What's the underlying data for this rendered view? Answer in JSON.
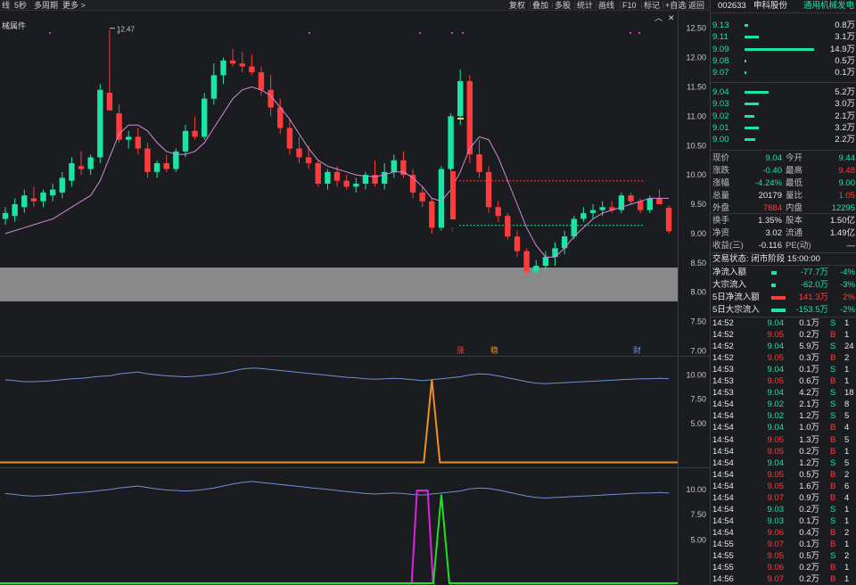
{
  "toolbar": {
    "left": [
      "线",
      "5秒",
      "多周期",
      "更多 >"
    ],
    "right": [
      "复权",
      "叠加",
      "多股",
      "统计",
      "画线",
      "F10",
      "标记",
      "+自选",
      "返回"
    ],
    "icons": [
      "chevron-up-icon",
      "close-icon"
    ]
  },
  "chart": {
    "indicator_label": "械属件",
    "high_label": "12.47",
    "signal_labels": [
      "涨",
      "稳",
      "财"
    ],
    "price_axis": [
      "12.50",
      "12.00",
      "11.50",
      "11.00",
      "10.50",
      "10.00",
      "9.50",
      "9.00",
      "8.50",
      "8.00",
      "7.50",
      "7.00"
    ],
    "sub1_axis": [
      "10.00",
      "7.50",
      "5.00"
    ],
    "sub2_axis": [
      "10.00",
      "7.50",
      "5.00"
    ],
    "colors": {
      "up": "#19e6a5",
      "down": "#ff3c3c",
      "ma": "#d08cd8",
      "blue": "#6e90d8",
      "orange": "#f0901e",
      "magenta": "#e020e0",
      "green": "#20e020",
      "gray_band": "#888888"
    }
  },
  "chart_data": {
    "type": "candlestick",
    "ylim": [
      6.9,
      12.8
    ],
    "candles": [
      {
        "o": 9.25,
        "h": 9.45,
        "l": 9.15,
        "c": 9.35
      },
      {
        "o": 9.3,
        "h": 9.6,
        "l": 9.2,
        "c": 9.5
      },
      {
        "o": 9.45,
        "h": 9.75,
        "l": 9.35,
        "c": 9.65
      },
      {
        "o": 9.6,
        "h": 9.8,
        "l": 9.45,
        "c": 9.55
      },
      {
        "o": 9.55,
        "h": 9.75,
        "l": 9.45,
        "c": 9.7
      },
      {
        "o": 9.65,
        "h": 9.85,
        "l": 9.55,
        "c": 9.75
      },
      {
        "o": 9.7,
        "h": 10.05,
        "l": 9.6,
        "c": 9.95
      },
      {
        "o": 9.9,
        "h": 10.3,
        "l": 9.8,
        "c": 10.2
      },
      {
        "o": 10.15,
        "h": 10.4,
        "l": 10.0,
        "c": 10.1
      },
      {
        "o": 10.1,
        "h": 10.35,
        "l": 10.0,
        "c": 10.3
      },
      {
        "o": 10.3,
        "h": 11.55,
        "l": 10.2,
        "c": 11.45
      },
      {
        "o": 11.4,
        "h": 12.47,
        "l": 11.1,
        "c": 11.1
      },
      {
        "o": 11.05,
        "h": 11.2,
        "l": 10.55,
        "c": 10.6
      },
      {
        "o": 10.6,
        "h": 10.75,
        "l": 10.45,
        "c": 10.65
      },
      {
        "o": 10.65,
        "h": 10.8,
        "l": 10.35,
        "c": 10.45
      },
      {
        "o": 10.45,
        "h": 10.55,
        "l": 9.95,
        "c": 10.05
      },
      {
        "o": 10.05,
        "h": 10.25,
        "l": 9.95,
        "c": 10.2
      },
      {
        "o": 10.2,
        "h": 10.35,
        "l": 10.05,
        "c": 10.1
      },
      {
        "o": 10.1,
        "h": 10.45,
        "l": 10.05,
        "c": 10.4
      },
      {
        "o": 10.4,
        "h": 10.85,
        "l": 10.3,
        "c": 10.75
      },
      {
        "o": 10.75,
        "h": 11.0,
        "l": 10.6,
        "c": 10.65
      },
      {
        "o": 10.65,
        "h": 11.4,
        "l": 10.6,
        "c": 11.3
      },
      {
        "o": 11.3,
        "h": 11.9,
        "l": 11.2,
        "c": 11.7
      },
      {
        "o": 11.7,
        "h": 12.0,
        "l": 11.55,
        "c": 11.95
      },
      {
        "o": 11.95,
        "h": 12.15,
        "l": 11.85,
        "c": 11.9
      },
      {
        "o": 11.9,
        "h": 12.1,
        "l": 11.75,
        "c": 11.85
      },
      {
        "o": 11.85,
        "h": 12.05,
        "l": 11.7,
        "c": 11.75
      },
      {
        "o": 11.75,
        "h": 11.85,
        "l": 11.35,
        "c": 11.45
      },
      {
        "o": 11.45,
        "h": 11.7,
        "l": 11.0,
        "c": 11.15
      },
      {
        "o": 11.15,
        "h": 11.3,
        "l": 10.7,
        "c": 10.8
      },
      {
        "o": 10.8,
        "h": 10.95,
        "l": 10.35,
        "c": 10.45
      },
      {
        "o": 10.45,
        "h": 10.65,
        "l": 10.2,
        "c": 10.3
      },
      {
        "o": 10.3,
        "h": 10.5,
        "l": 10.1,
        "c": 10.2
      },
      {
        "o": 10.2,
        "h": 10.25,
        "l": 9.8,
        "c": 9.85
      },
      {
        "o": 9.85,
        "h": 10.1,
        "l": 9.75,
        "c": 10.05
      },
      {
        "o": 10.05,
        "h": 10.15,
        "l": 9.8,
        "c": 9.9
      },
      {
        "o": 9.9,
        "h": 10.0,
        "l": 9.75,
        "c": 9.8
      },
      {
        "o": 9.8,
        "h": 9.95,
        "l": 9.7,
        "c": 9.85
      },
      {
        "o": 9.85,
        "h": 10.05,
        "l": 9.75,
        "c": 10.0
      },
      {
        "o": 10.0,
        "h": 10.25,
        "l": 9.8,
        "c": 9.85
      },
      {
        "o": 9.85,
        "h": 10.2,
        "l": 9.75,
        "c": 10.05
      },
      {
        "o": 10.05,
        "h": 10.35,
        "l": 9.95,
        "c": 10.25
      },
      {
        "o": 10.25,
        "h": 10.4,
        "l": 9.95,
        "c": 10.0
      },
      {
        "o": 10.0,
        "h": 10.1,
        "l": 9.6,
        "c": 9.7
      },
      {
        "o": 9.7,
        "h": 9.8,
        "l": 9.45,
        "c": 9.55
      },
      {
        "o": 9.55,
        "h": 9.6,
        "l": 9.0,
        "c": 9.1
      },
      {
        "o": 9.1,
        "h": 10.15,
        "l": 9.05,
        "c": 10.1
      },
      {
        "o": 10.1,
        "h": 11.05,
        "l": 10.05,
        "c": 11.0
      },
      {
        "o": 11.0,
        "h": 11.8,
        "l": 10.85,
        "c": 11.6
      },
      {
        "o": 11.6,
        "h": 11.7,
        "l": 10.2,
        "c": 10.35
      },
      {
        "o": 10.35,
        "h": 10.6,
        "l": 9.95,
        "c": 10.05
      },
      {
        "o": 10.05,
        "h": 10.15,
        "l": 9.35,
        "c": 9.45
      },
      {
        "o": 9.45,
        "h": 9.55,
        "l": 9.2,
        "c": 9.3
      },
      {
        "o": 9.3,
        "h": 9.35,
        "l": 8.9,
        "c": 8.95
      },
      {
        "o": 8.95,
        "h": 9.05,
        "l": 8.6,
        "c": 8.7
      },
      {
        "o": 8.7,
        "h": 8.75,
        "l": 8.3,
        "c": 8.35
      },
      {
        "o": 8.35,
        "h": 8.55,
        "l": 8.3,
        "c": 8.45
      },
      {
        "o": 8.45,
        "h": 8.7,
        "l": 8.35,
        "c": 8.6
      },
      {
        "o": 8.6,
        "h": 8.85,
        "l": 8.45,
        "c": 8.75
      },
      {
        "o": 8.75,
        "h": 9.05,
        "l": 8.65,
        "c": 8.95
      },
      {
        "o": 8.95,
        "h": 9.3,
        "l": 8.9,
        "c": 9.25
      },
      {
        "o": 9.25,
        "h": 9.45,
        "l": 9.2,
        "c": 9.35
      },
      {
        "o": 9.35,
        "h": 9.5,
        "l": 9.25,
        "c": 9.4
      },
      {
        "o": 9.4,
        "h": 9.55,
        "l": 9.3,
        "c": 9.45
      },
      {
        "o": 9.45,
        "h": 9.55,
        "l": 9.35,
        "c": 9.4
      },
      {
        "o": 9.4,
        "h": 9.7,
        "l": 9.35,
        "c": 9.65
      },
      {
        "o": 9.65,
        "h": 9.7,
        "l": 9.5,
        "c": 9.55
      },
      {
        "o": 9.55,
        "h": 9.6,
        "l": 9.35,
        "c": 9.4
      },
      {
        "o": 9.4,
        "h": 9.65,
        "l": 9.35,
        "c": 9.6
      },
      {
        "o": 9.6,
        "h": 9.75,
        "l": 9.5,
        "c": 9.5
      },
      {
        "o": 9.44,
        "h": 9.48,
        "l": 9.0,
        "c": 9.04
      }
    ],
    "ma": [
      9.0,
      9.05,
      9.1,
      9.15,
      9.2,
      9.25,
      9.35,
      9.45,
      9.55,
      9.65,
      9.9,
      10.3,
      10.7,
      10.85,
      10.85,
      10.75,
      10.55,
      10.4,
      10.35,
      10.35,
      10.4,
      10.55,
      10.8,
      11.05,
      11.3,
      11.45,
      11.5,
      11.45,
      11.35,
      11.15,
      10.95,
      10.7,
      10.45,
      10.25,
      10.15,
      10.1,
      10.05,
      10.0,
      9.98,
      9.97,
      10.0,
      10.05,
      10.05,
      9.95,
      9.8,
      9.6,
      9.55,
      9.75,
      10.05,
      10.45,
      10.65,
      10.6,
      10.3,
      9.9,
      9.5,
      9.1,
      8.8,
      8.6,
      8.6,
      8.75,
      8.95,
      9.1,
      9.25,
      9.35,
      9.4,
      9.45,
      9.5,
      9.55,
      9.6,
      9.6,
      9.6
    ],
    "ref_levels": [
      9.9,
      9.14
    ],
    "sub1": {
      "blue": [
        9.5,
        9.4,
        9.3,
        9.3,
        9.35,
        9.4,
        9.5,
        9.6,
        9.65,
        9.75,
        9.85,
        9.9,
        10.1,
        10.2,
        10.3,
        10.1,
        10.0,
        9.9,
        9.85,
        9.8,
        9.85,
        9.95,
        10.05,
        10.2,
        10.4,
        10.6,
        10.7,
        10.65,
        10.55,
        10.45,
        10.35,
        10.25,
        10.15,
        10.05,
        9.95,
        9.85,
        9.75,
        9.7,
        9.6,
        9.55,
        9.6,
        9.65,
        9.6,
        9.5,
        9.4,
        9.5,
        9.6,
        9.7,
        9.8,
        10.0,
        10.1,
        10.05,
        9.9,
        9.7,
        9.5,
        9.3,
        9.15,
        9.1,
        9.15,
        9.2,
        9.25,
        9.3,
        9.35,
        9.4,
        9.45,
        9.5,
        9.55,
        9.6,
        9.6,
        9.65,
        9.6
      ],
      "orange_spike": {
        "index": 45,
        "value": 9.5
      }
    },
    "sub2": {
      "blue": [
        9.6,
        9.5,
        9.4,
        9.35,
        9.4,
        9.45,
        9.55,
        9.65,
        9.7,
        9.8,
        9.9,
        10.0,
        10.15,
        10.25,
        10.35,
        10.2,
        10.05,
        9.95,
        9.9,
        9.85,
        9.9,
        10.0,
        10.15,
        10.35,
        10.55,
        10.7,
        10.8,
        10.7,
        10.6,
        10.5,
        10.4,
        10.3,
        10.2,
        10.1,
        10.0,
        9.9,
        9.8,
        9.7,
        9.6,
        9.55,
        9.6,
        9.65,
        9.6,
        9.5,
        9.45,
        9.55,
        9.65,
        9.75,
        9.85,
        10.05,
        10.15,
        10.1,
        9.95,
        9.75,
        9.55,
        9.35,
        9.2,
        9.15,
        9.2,
        9.25,
        9.3,
        9.35,
        9.4,
        9.45,
        9.5,
        9.55,
        9.6,
        9.65,
        9.65,
        9.7,
        9.65
      ],
      "magenta_spike": {
        "index": 44,
        "value": 9.9
      },
      "green_spike": {
        "index": 46,
        "value": 9.5
      }
    }
  },
  "sidebar": {
    "code": "002633",
    "name": "申科股份",
    "tag": "通用机械发电",
    "asks": [
      {
        "price": "9.13",
        "vol": "0.8万",
        "ratio": 0.05
      },
      {
        "price": "9.11",
        "vol": "3.1万",
        "ratio": 0.21
      },
      {
        "price": "9.09",
        "vol": "14.9万",
        "ratio": 1.0
      },
      {
        "price": "9.08",
        "vol": "0.5万",
        "ratio": 0.03
      },
      {
        "price": "9.07",
        "vol": "0.1万",
        "ratio": 0.01
      }
    ],
    "bids": [
      {
        "price": "9.04",
        "vol": "5.2万",
        "ratio": 0.35
      },
      {
        "price": "9.03",
        "vol": "3.0万",
        "ratio": 0.2
      },
      {
        "price": "9.02",
        "vol": "2.1万",
        "ratio": 0.14
      },
      {
        "price": "9.01",
        "vol": "3.2万",
        "ratio": 0.21
      },
      {
        "price": "9.00",
        "vol": "2.2万",
        "ratio": 0.15
      }
    ],
    "quotes": [
      {
        "k1": "现价",
        "v1": "9.04",
        "c1": "grn",
        "k2": "今开",
        "v2": "9.44",
        "c2": "grn"
      },
      {
        "k1": "涨跌",
        "v1": "-0.40",
        "c1": "grn",
        "k2": "最高",
        "v2": "9.48",
        "c2": "red"
      },
      {
        "k1": "涨幅",
        "v1": "-4.24%",
        "c1": "grn",
        "k2": "最低",
        "v2": "9.00",
        "c2": "grn"
      },
      {
        "k1": "总量",
        "v1": "20179",
        "c1": "wht",
        "k2": "量比",
        "v2": "1.05",
        "c2": "red"
      },
      {
        "k1": "外盘",
        "v1": "7884",
        "c1": "red",
        "k2": "内盘",
        "v2": "12295",
        "c2": "grn"
      }
    ],
    "fundamentals": [
      {
        "k1": "换手",
        "v1": "1.35%",
        "k2": "股本",
        "v2": "1.50亿"
      },
      {
        "k1": "净资",
        "v1": "3.02",
        "k2": "流通",
        "v2": "1.49亿"
      },
      {
        "k1": "收益(三)",
        "v1": "-0.116",
        "k2": "PE(动)",
        "v2": "—"
      }
    ],
    "trade_status": "交易状态: 闭市阶段 15:00:00",
    "flows": [
      {
        "label": "净流入额",
        "value": "-77.7万",
        "pct": "-4%",
        "bar_color": "#19e6a5",
        "bar_w": 6,
        "vc": "grn"
      },
      {
        "label": "大宗流入",
        "value": "-62.0万",
        "pct": "-3%",
        "bar_color": "#19e6a5",
        "bar_w": 5,
        "vc": "grn"
      },
      {
        "label": "5日净流入额",
        "value": "141.3万",
        "pct": "2%",
        "bar_color": "#ff3c3c",
        "bar_w": 16,
        "vc": "red"
      },
      {
        "label": "5日大宗流入",
        "value": "-153.5万",
        "pct": "-2%",
        "bar_color": "#19e6a5",
        "bar_w": 16,
        "vc": "grn"
      }
    ],
    "ticks": [
      {
        "t": "14:52",
        "p": "9.04",
        "v": "0.1万",
        "s": "S",
        "e": "1"
      },
      {
        "t": "14:52",
        "p": "9.05",
        "v": "0.2万",
        "s": "B",
        "e": "1"
      },
      {
        "t": "14:52",
        "p": "9.04",
        "v": "5.9万",
        "s": "S",
        "e": "24"
      },
      {
        "t": "14:52",
        "p": "9.05",
        "v": "0.3万",
        "s": "B",
        "e": "2"
      },
      {
        "t": "14:53",
        "p": "9.04",
        "v": "0.1万",
        "s": "S",
        "e": "1"
      },
      {
        "t": "14:53",
        "p": "9.05",
        "v": "0.6万",
        "s": "B",
        "e": "1"
      },
      {
        "t": "14:53",
        "p": "9.04",
        "v": "4.2万",
        "s": "S",
        "e": "18"
      },
      {
        "t": "14:54",
        "p": "9.02",
        "v": "2.1万",
        "s": "S",
        "e": "8"
      },
      {
        "t": "14:54",
        "p": "9.02",
        "v": "1.2万",
        "s": "S",
        "e": "5"
      },
      {
        "t": "14:54",
        "p": "9.04",
        "v": "1.0万",
        "s": "B",
        "e": "4"
      },
      {
        "t": "14:54",
        "p": "9.05",
        "v": "1.3万",
        "s": "B",
        "e": "5"
      },
      {
        "t": "14:54",
        "p": "9.05",
        "v": "0.2万",
        "s": "B",
        "e": "1"
      },
      {
        "t": "14:54",
        "p": "9.04",
        "v": "1.2万",
        "s": "S",
        "e": "5"
      },
      {
        "t": "14:54",
        "p": "9.05",
        "v": "0.5万",
        "s": "B",
        "e": "2"
      },
      {
        "t": "14:54",
        "p": "9.05",
        "v": "1.6万",
        "s": "B",
        "e": "6"
      },
      {
        "t": "14:54",
        "p": "9.07",
        "v": "0.9万",
        "s": "B",
        "e": "4"
      },
      {
        "t": "14:54",
        "p": "9.03",
        "v": "0.2万",
        "s": "S",
        "e": "1"
      },
      {
        "t": "14:54",
        "p": "9.03",
        "v": "0.1万",
        "s": "S",
        "e": "1"
      },
      {
        "t": "14:54",
        "p": "9.06",
        "v": "0.4万",
        "s": "B",
        "e": "2"
      },
      {
        "t": "14:55",
        "p": "9.07",
        "v": "0.1万",
        "s": "B",
        "e": "1"
      },
      {
        "t": "14:55",
        "p": "9.05",
        "v": "0.5万",
        "s": "S",
        "e": "2"
      },
      {
        "t": "14:55",
        "p": "9.06",
        "v": "0.2万",
        "s": "B",
        "e": "1"
      },
      {
        "t": "14:56",
        "p": "9.07",
        "v": "0.2万",
        "s": "B",
        "e": "1"
      }
    ]
  }
}
